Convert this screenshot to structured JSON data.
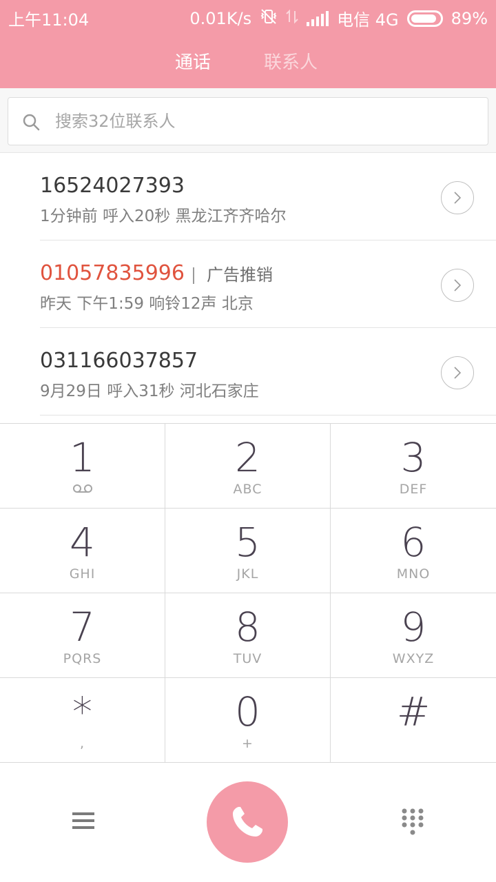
{
  "status_bar": {
    "time": "上午11:04",
    "net_speed": "0.01K/s",
    "carrier": "电信 4G",
    "battery": "89%",
    "battery_level": 0.89,
    "icons": [
      "vibrate-off-icon",
      "data-arrows-icon",
      "signal-icon",
      "battery-icon"
    ]
  },
  "tabs": [
    {
      "label": "通话",
      "active": true
    },
    {
      "label": "联系人",
      "active": false
    }
  ],
  "search": {
    "placeholder": "搜索32位联系人",
    "icon": "search-icon"
  },
  "call_log": [
    {
      "number": "16524027393",
      "label": "",
      "meta": "1分钟前 呼入20秒 黑龙江齐齐哈尔",
      "spam": false
    },
    {
      "number": "01057835996",
      "label": "广告推销",
      "meta": "昨天 下午1:59 响铃12声 北京",
      "spam": true
    },
    {
      "number": "031166037857",
      "label": "",
      "meta": "9月29日 呼入31秒 河北石家庄",
      "spam": false
    }
  ],
  "keypad": [
    {
      "digit": "1",
      "letters": "",
      "icon": "voicemail-icon"
    },
    {
      "digit": "2",
      "letters": "ABC"
    },
    {
      "digit": "3",
      "letters": "DEF"
    },
    {
      "digit": "4",
      "letters": "GHI"
    },
    {
      "digit": "5",
      "letters": "JKL"
    },
    {
      "digit": "6",
      "letters": "MNO"
    },
    {
      "digit": "7",
      "letters": "PQRS"
    },
    {
      "digit": "8",
      "letters": "TUV"
    },
    {
      "digit": "9",
      "letters": "WXYZ"
    },
    {
      "digit": "*",
      "letters": ","
    },
    {
      "digit": "0",
      "letters": "+"
    },
    {
      "digit": "#",
      "letters": ""
    }
  ],
  "bottom_bar": {
    "icons": [
      "menu-icon",
      "phone-icon",
      "dialpad-icon"
    ]
  },
  "colors": {
    "accent": "#f49ba8",
    "spam_number": "#e0533e",
    "digit": "#4a4250",
    "letters": "#a5a5a5"
  }
}
